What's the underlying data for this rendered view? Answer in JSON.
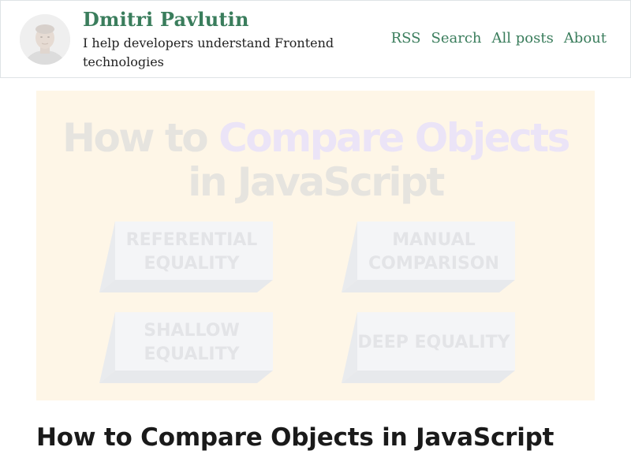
{
  "site": {
    "name": "Dmitri Pavlutin",
    "tagline": "I help developers understand Frontend technologies",
    "avatar_alt": "Dmitri Pavlutin"
  },
  "nav": [
    {
      "label": "RSS"
    },
    {
      "label": "Search"
    },
    {
      "label": "All posts"
    },
    {
      "label": "About"
    }
  ],
  "hero": {
    "title_part1": "How to ",
    "title_accent": "Compare Objects",
    "title_line2": "in JavaScript",
    "boxes": [
      {
        "label": "REFERENTIAL EQUALITY"
      },
      {
        "label": "MANUAL COMPARISON"
      },
      {
        "label": "SHALLOW EQUALITY"
      },
      {
        "label": "DEEP EQUALITY"
      }
    ],
    "colors": {
      "background": "#fef6e7",
      "title": "#e6e4df",
      "accent": "#ebe4f7",
      "box_face": "#f4f5f7",
      "box_side": "#e9ebee"
    }
  },
  "article": {
    "title": "How to Compare Objects in JavaScript"
  },
  "theme": {
    "brand_green": "#3a7d5c",
    "text": "#222222",
    "heading": "#1a1a1a",
    "header_border": "#dfe3e6"
  }
}
